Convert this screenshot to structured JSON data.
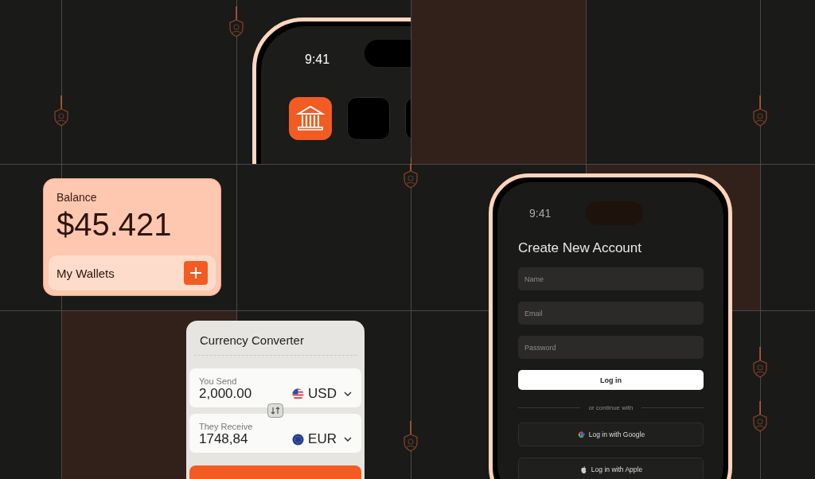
{
  "top_phone": {
    "time": "9:41"
  },
  "balance_card": {
    "label": "Balance",
    "amount": "$45.421",
    "wallets_label": "My Wallets"
  },
  "converter": {
    "title": "Currency Converter",
    "rows": [
      {
        "label": "You Send",
        "amount": "2,000.00",
        "currency": "USD",
        "kind": "us"
      },
      {
        "label": "They Receive",
        "amount": "1748,84",
        "currency": "EUR",
        "kind": "eu"
      }
    ]
  },
  "signup_phone": {
    "time": "9:41",
    "title": "Create New Account",
    "fields": [
      {
        "placeholder": "Name"
      },
      {
        "placeholder": "Email"
      },
      {
        "placeholder": "Password"
      }
    ],
    "primary_button": "Log in",
    "divider": "or continue with",
    "social_buttons": [
      {
        "label": "Log in with Google",
        "kind": "google"
      },
      {
        "label": "Log in with Apple",
        "kind": "apple"
      }
    ]
  }
}
